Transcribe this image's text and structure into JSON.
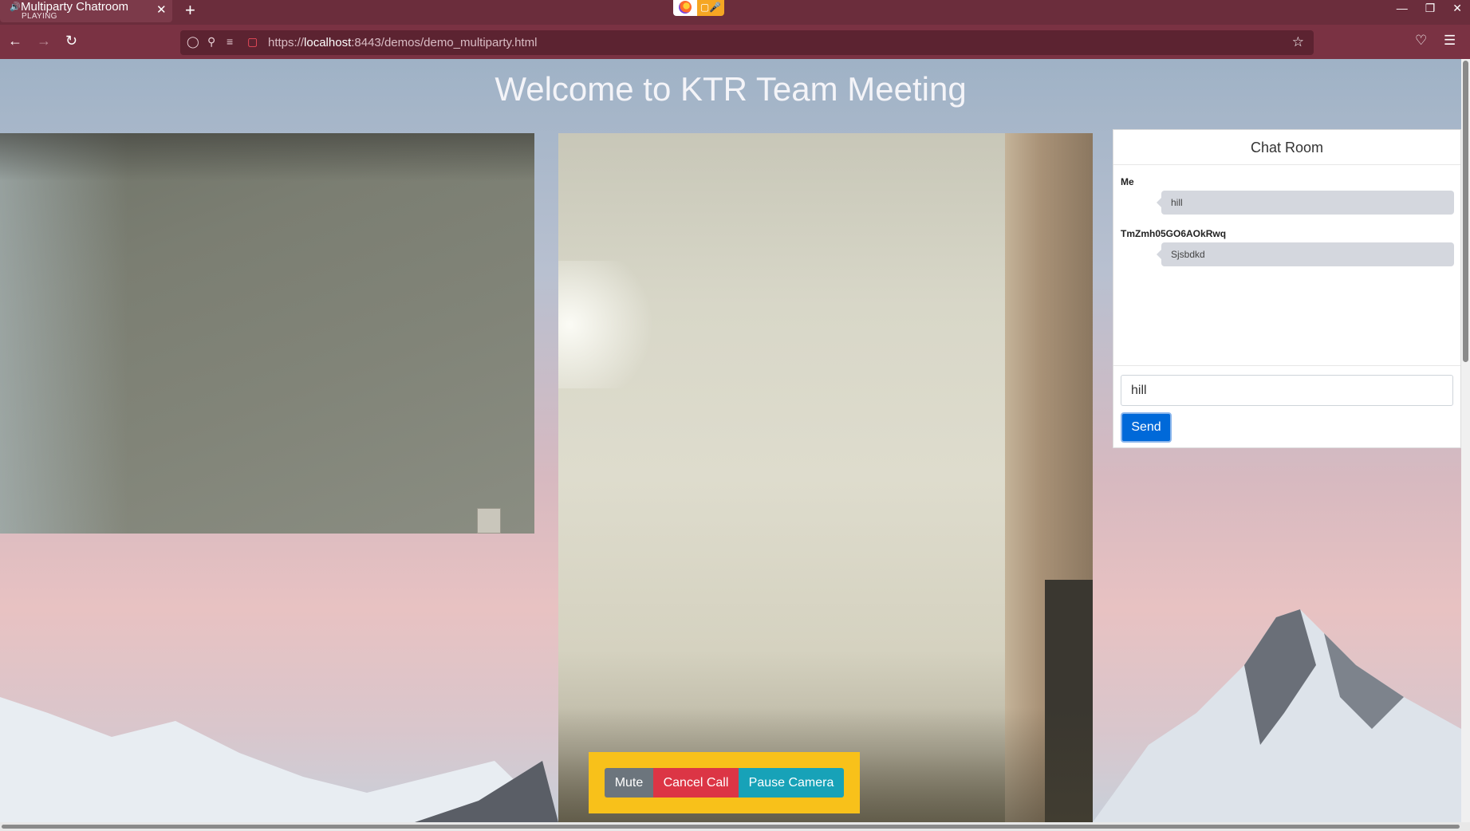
{
  "browser": {
    "tab_title": "Multiparty Chatroom",
    "tab_subtitle": "PLAYING",
    "url_prefix": "https://",
    "url_host": "localhost",
    "url_rest": ":8443/demos/demo_multiparty.html",
    "accent_color": "#6b2d3c"
  },
  "page": {
    "title": "Welcome to KTR Team Meeting"
  },
  "chat": {
    "header": "Chat Room",
    "messages": [
      {
        "sender": "Me",
        "text": "hill"
      },
      {
        "sender": "TmZmh05GO6AOkRwq",
        "text": "Sjsbdkd"
      }
    ],
    "input_value": "hill",
    "send_label": "Send",
    "send_color": "#0069d9"
  },
  "controls": {
    "mute_label": "Mute",
    "cancel_label": "Cancel Call",
    "pause_label": "Pause Camera",
    "panel_color": "#f8c11a"
  }
}
